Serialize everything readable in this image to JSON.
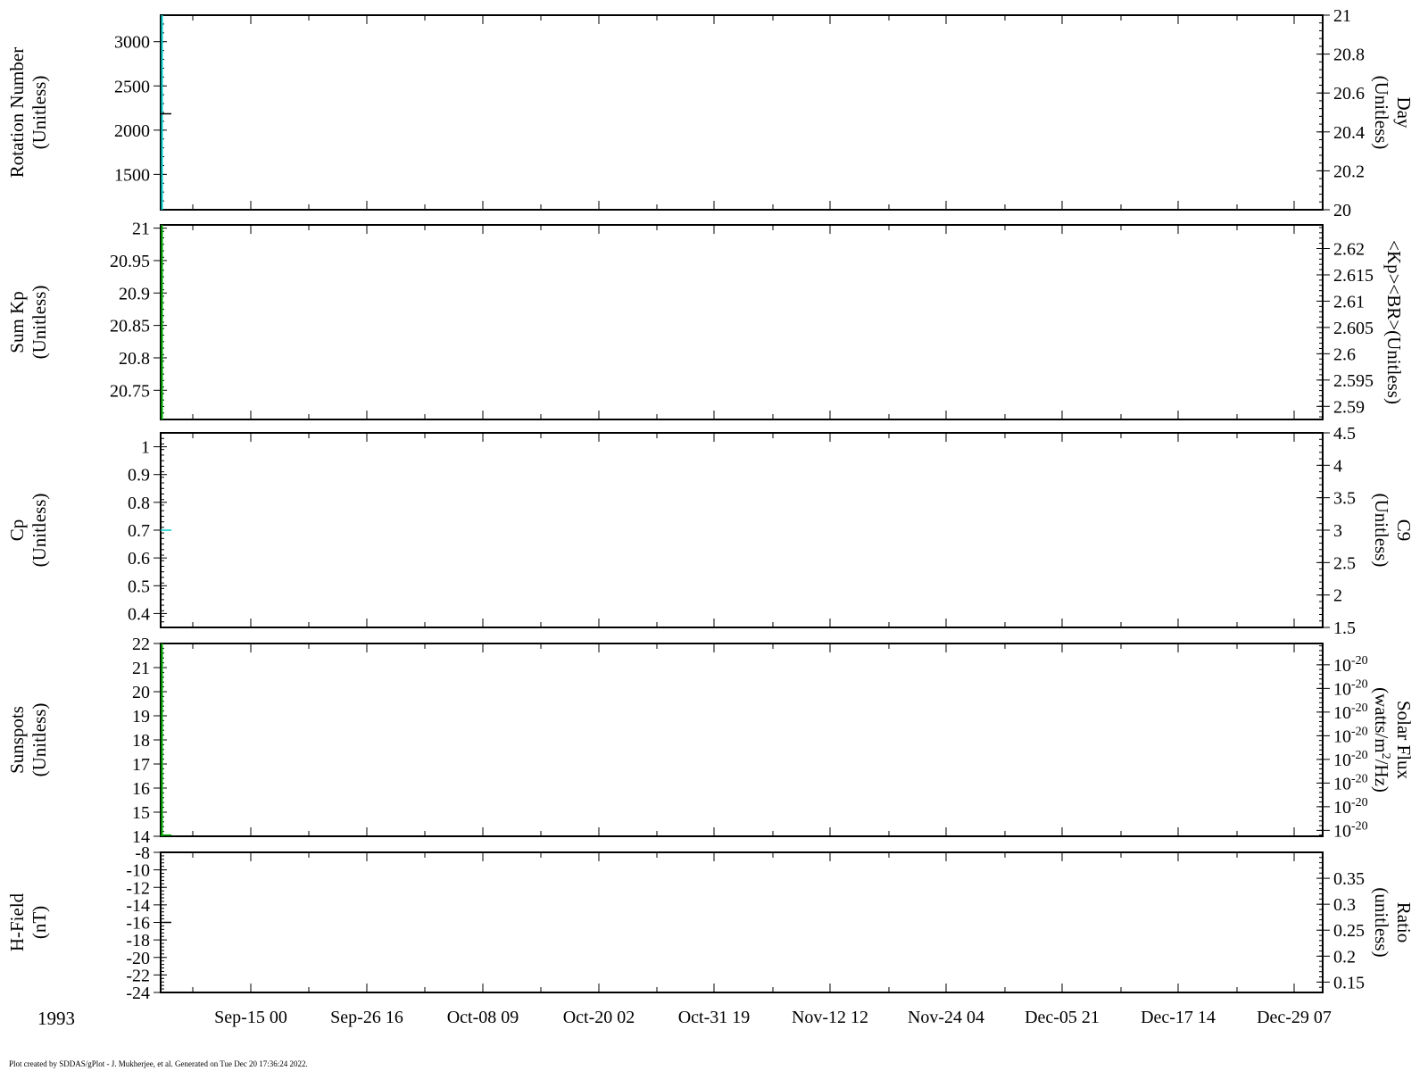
{
  "colors": {
    "axis": "#000000",
    "series_cyan": "#00d0d0",
    "series_green": "#00b000",
    "background": "#ffffff"
  },
  "footer": "Plot created by SDDAS/gPlot - J. Mukherjee, et al.  Generated on Tue Dec 20 17:36:24 2022.",
  "chart_data": [
    {
      "type": "line",
      "year_label": "1993",
      "x_axis": {
        "tick_labels": [
          "Sep-15 00",
          "Sep-26 16",
          "Oct-08 09",
          "Oct-20 02",
          "Oct-31 19",
          "Nov-12 12",
          "Nov-24 04",
          "Dec-05 21",
          "Dec-17 14",
          "Dec-29 07"
        ]
      },
      "panels": [
        {
          "left": {
            "label": [
              "Rotation Number",
              "(Unitless)"
            ],
            "ylim": [
              1100,
              3300
            ],
            "ticks": [
              1500,
              2000,
              2500,
              3000
            ],
            "tick_labels": [
              "1500",
              "2000",
              "2500",
              "3000"
            ]
          },
          "right": {
            "label": [
              "Day",
              "(Unitless)"
            ],
            "ylim": [
              20,
              21
            ],
            "ticks": [
              20,
              20.2,
              20.4,
              20.6,
              20.8,
              21
            ],
            "tick_labels": [
              "20",
              "20.2",
              "20.4",
              "20.6",
              "20.8",
              "21"
            ]
          },
          "marks": [
            {
              "kind": "vline",
              "axis": "left",
              "y_from": 1100,
              "y_to": 3300,
              "color": "series_cyan"
            },
            {
              "kind": "hmark",
              "axis": "left",
              "y": 2185,
              "color": "axis"
            }
          ]
        },
        {
          "left": {
            "label": [
              "Sum Kp",
              "(Unitless)"
            ],
            "ylim": [
              20.705,
              21.005
            ],
            "ticks": [
              20.75,
              20.8,
              20.85,
              20.9,
              20.95,
              21
            ],
            "tick_labels": [
              "20.75",
              "20.8",
              "20.85",
              "20.9",
              "20.95",
              "21"
            ]
          },
          "right": {
            "label": [
              "<Kp><BR>(Unitless)"
            ],
            "ylim": [
              2.5875,
              2.6245
            ],
            "ticks": [
              2.59,
              2.595,
              2.6,
              2.605,
              2.61,
              2.615,
              2.62
            ],
            "tick_labels": [
              "2.59",
              "2.595",
              "2.6",
              "2.605",
              "2.61",
              "2.615",
              "2.62"
            ]
          },
          "marks": [
            {
              "kind": "vline",
              "axis": "left",
              "y_from": 20.705,
              "y_to": 21.005,
              "color": "series_green"
            }
          ]
        },
        {
          "left": {
            "label": [
              "Cp",
              "(Unitless)"
            ],
            "ylim": [
              0.35,
              1.05
            ],
            "ticks": [
              0.4,
              0.5,
              0.6,
              0.7,
              0.8,
              0.9,
              1
            ],
            "tick_labels": [
              "0.4",
              "0.5",
              "0.6",
              "0.7",
              "0.8",
              "0.9",
              "1"
            ]
          },
          "right": {
            "label": [
              "C9",
              "(Unitless)"
            ],
            "ylim": [
              1.5,
              4.5
            ],
            "ticks": [
              1.5,
              2,
              2.5,
              3,
              3.5,
              4,
              4.5
            ],
            "tick_labels": [
              "1.5",
              "2",
              "2.5",
              "3",
              "3.5",
              "4",
              "4.5"
            ]
          },
          "marks": [
            {
              "kind": "hmark",
              "axis": "left",
              "y": 0.7,
              "color": "series_cyan"
            }
          ]
        },
        {
          "left": {
            "label": [
              "Sunspots",
              "(Unitless)"
            ],
            "ylim": [
              14,
              22
            ],
            "ticks": [
              14,
              15,
              16,
              17,
              18,
              19,
              20,
              21,
              22
            ],
            "tick_labels": [
              "14",
              "15",
              "16",
              "17",
              "18",
              "19",
              "20",
              "21",
              "22"
            ]
          },
          "right": {
            "label": [
              "Solar Flux",
              "(watts/m²/Hz)"
            ],
            "ylim": [
              0,
              8.15
            ],
            "ticks": [
              0.25,
              1.25,
              2.25,
              3.25,
              4.25,
              5.25,
              6.25,
              7.25
            ],
            "tick_labels": [
              "10⁻²⁰",
              "10⁻²⁰",
              "10⁻²⁰",
              "10⁻²⁰",
              "10⁻²⁰",
              "10⁻²⁰",
              "10⁻²⁰",
              "10⁻²⁰"
            ]
          },
          "marks": [
            {
              "kind": "vline",
              "axis": "left",
              "y_from": 14,
              "y_to": 22,
              "color": "series_green"
            },
            {
              "kind": "hmark",
              "axis": "left",
              "y": 14.05,
              "color": "series_green"
            }
          ]
        },
        {
          "left": {
            "label": [
              "H-Field",
              "(nT)"
            ],
            "ylim": [
              -24,
              -8
            ],
            "ticks": [
              -24,
              -22,
              -20,
              -18,
              -16,
              -14,
              -12,
              -10,
              -8
            ],
            "tick_labels": [
              "-24",
              "-22",
              "-20",
              "-18",
              "-16",
              "-14",
              "-12",
              "-10",
              "-8"
            ]
          },
          "right": {
            "label": [
              "Ratio",
              "(unitless)"
            ],
            "ylim": [
              0.13,
              0.4
            ],
            "ticks": [
              0.15,
              0.2,
              0.25,
              0.3,
              0.35
            ],
            "tick_labels": [
              "0.15",
              "0.2",
              "0.25",
              "0.3",
              "0.35"
            ]
          },
          "marks": [
            {
              "kind": "hmark",
              "axis": "left",
              "y": -16,
              "color": "axis"
            }
          ]
        }
      ]
    }
  ]
}
